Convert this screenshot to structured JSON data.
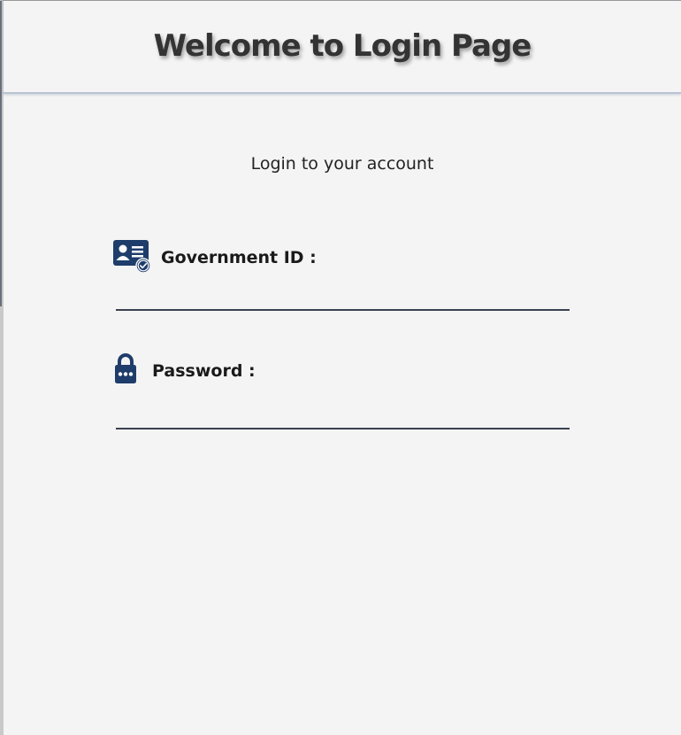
{
  "header": {
    "title": "Welcome to Login Page"
  },
  "main": {
    "subtitle": "Login to your account"
  },
  "form": {
    "government_id": {
      "label": "Government ID :",
      "value": "",
      "icon": "id-card-icon"
    },
    "password": {
      "label": "Password :",
      "value": "",
      "icon": "lock-icon"
    }
  },
  "colors": {
    "icon_navy": "#1f3d6b",
    "background": "#f4f4f4",
    "underline": "#3a4250",
    "header_border": "#b9c3d2"
  }
}
